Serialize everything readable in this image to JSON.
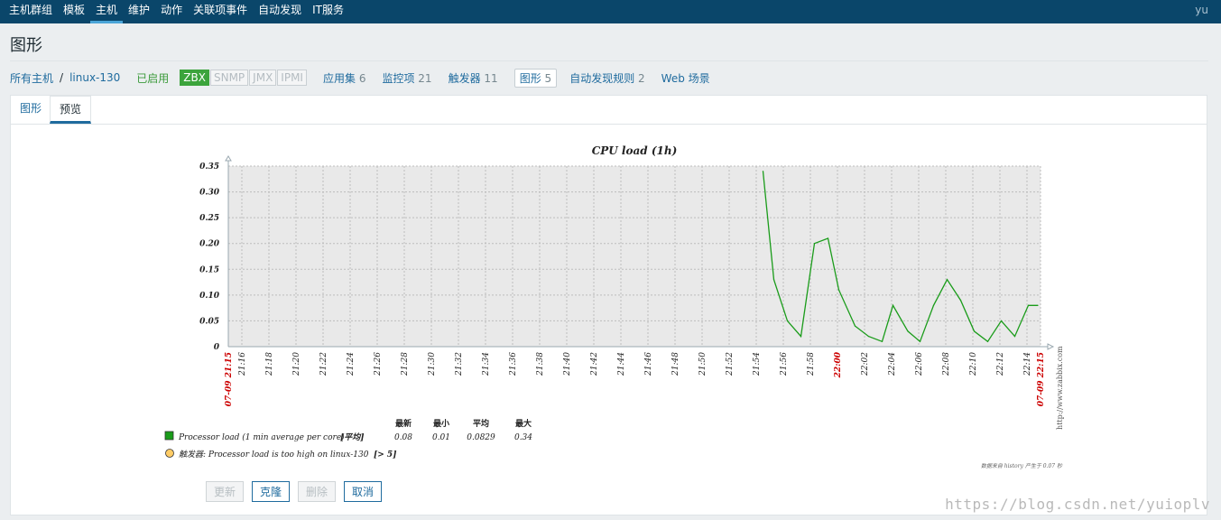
{
  "nav": {
    "items": [
      "主机群组",
      "模板",
      "主机",
      "维护",
      "动作",
      "关联项事件",
      "自动发现",
      "IT服务"
    ],
    "active_index": 2,
    "user": "yu"
  },
  "page_title": "图形",
  "breadcrumb": {
    "all_hosts": "所有主机",
    "sep": "/",
    "host": "linux-130",
    "status": "已启用",
    "badges": [
      "ZBX",
      "SNMP",
      "JMX",
      "IPMI"
    ],
    "links": [
      {
        "label": "应用集",
        "count": "6"
      },
      {
        "label": "监控项",
        "count": "21"
      },
      {
        "label": "触发器",
        "count": "11"
      },
      {
        "label": "图形",
        "count": "5"
      },
      {
        "label": "自动发现规则",
        "count": "2"
      },
      {
        "label": "Web 场景",
        "count": ""
      }
    ]
  },
  "tabs": [
    "图形",
    "预览"
  ],
  "buttons": {
    "update": "更新",
    "clone": "克隆",
    "delete": "删除",
    "cancel": "取消"
  },
  "watermark": "https://blog.csdn.net/yuioplv",
  "colors": {
    "topnav": "#0a466a",
    "series": "#1a9c1a",
    "trigger": "#ffcc66",
    "date_label": "#cc0000"
  },
  "chart_data": {
    "type": "line",
    "title": "CPU load (1h)",
    "ylim": [
      0,
      0.35
    ],
    "y_ticks": [
      "0",
      "0.05",
      "0.10",
      "0.15",
      "0.20",
      "0.25",
      "0.30",
      "0.35"
    ],
    "x_ticks": [
      "07-09 21:15",
      "21:16",
      "21:18",
      "21:20",
      "21:22",
      "21:24",
      "21:26",
      "21:28",
      "21:30",
      "21:32",
      "21:34",
      "21:36",
      "21:38",
      "21:40",
      "21:42",
      "21:44",
      "21:46",
      "21:48",
      "21:50",
      "21:52",
      "21:54",
      "21:56",
      "21:58",
      "22:00",
      "22:02",
      "22:04",
      "22:06",
      "22:08",
      "22:10",
      "22:12",
      "22:14",
      "07-09 22:15"
    ],
    "x_tick_minutes": [
      0,
      1,
      3,
      5,
      7,
      9,
      11,
      13,
      15,
      17,
      19,
      21,
      23,
      25,
      27,
      29,
      31,
      33,
      35,
      37,
      39,
      41,
      43,
      45,
      47,
      49,
      51,
      53,
      55,
      57,
      59,
      60
    ],
    "red_tick_labels": [
      "07-09 21:15",
      "22:00",
      "07-09 22:15"
    ],
    "side_text": "http://www.zabbix.com",
    "series": [
      {
        "name": "Processor load (1 min average per core)",
        "func": "[平均]",
        "last": "0.08",
        "min": "0.01",
        "avg": "0.0829",
        "max": "0.34",
        "x_minutes": [
          39.5,
          40.3,
          41.3,
          42.3,
          43.3,
          44.3,
          45.1,
          46.3,
          47.3,
          48.3,
          49.1,
          50.2,
          51.1,
          52.1,
          53.1,
          54.1,
          55.1,
          56.1,
          57.1,
          58.1,
          59.1,
          59.8
        ],
        "values": [
          0.34,
          0.13,
          0.05,
          0.02,
          0.2,
          0.21,
          0.11,
          0.04,
          0.02,
          0.01,
          0.08,
          0.03,
          0.01,
          0.08,
          0.13,
          0.09,
          0.03,
          0.01,
          0.05,
          0.02,
          0.08,
          0.08
        ]
      }
    ],
    "legend_headers": [
      "最新",
      "最小",
      "平均",
      "最大"
    ],
    "trigger": {
      "label": "触发器: Processor load is too high on linux-130",
      "value": "[> 5]"
    },
    "footer": "数据来自 history 产生于 0.07 秒"
  }
}
